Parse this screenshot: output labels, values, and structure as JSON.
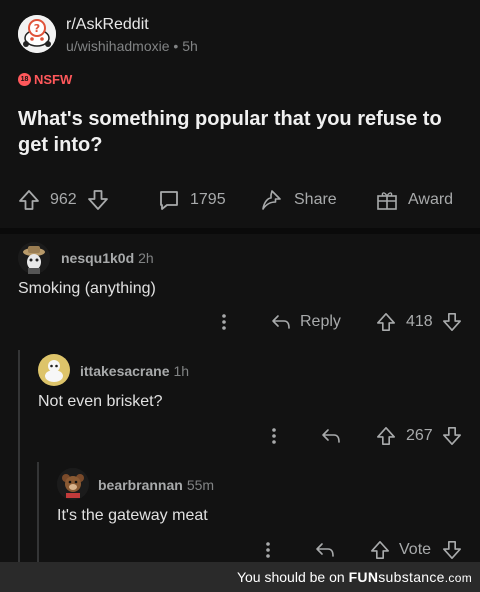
{
  "post": {
    "subreddit": "r/AskReddit",
    "author": "u/wishihadmoxie",
    "age": "5h",
    "nsfw_label": "NSFW",
    "title": "What's something popular that you refuse to get into?",
    "upvotes": "962",
    "comments": "1795",
    "share_label": "Share",
    "award_label": "Award"
  },
  "comments": [
    {
      "user": "nesqu1k0d",
      "time": "2h",
      "body": "Smoking (anything)",
      "score": "418",
      "reply_label": "Reply"
    },
    {
      "user": "ittakesacrane",
      "time": "1h",
      "body": "Not even brisket?",
      "score": "267"
    },
    {
      "user": "bearbrannan",
      "time": "55m",
      "body": "It's the gateway meat",
      "score": "Vote"
    }
  ],
  "footer": {
    "prefix": "You should be on",
    "brand_fun": "FUN",
    "brand_rest": "substance",
    "brand_tld": ".com"
  },
  "colors": {
    "background": "#121212",
    "text": "#d7dadc",
    "muted": "#818384",
    "nsfw": "#ff585b"
  }
}
